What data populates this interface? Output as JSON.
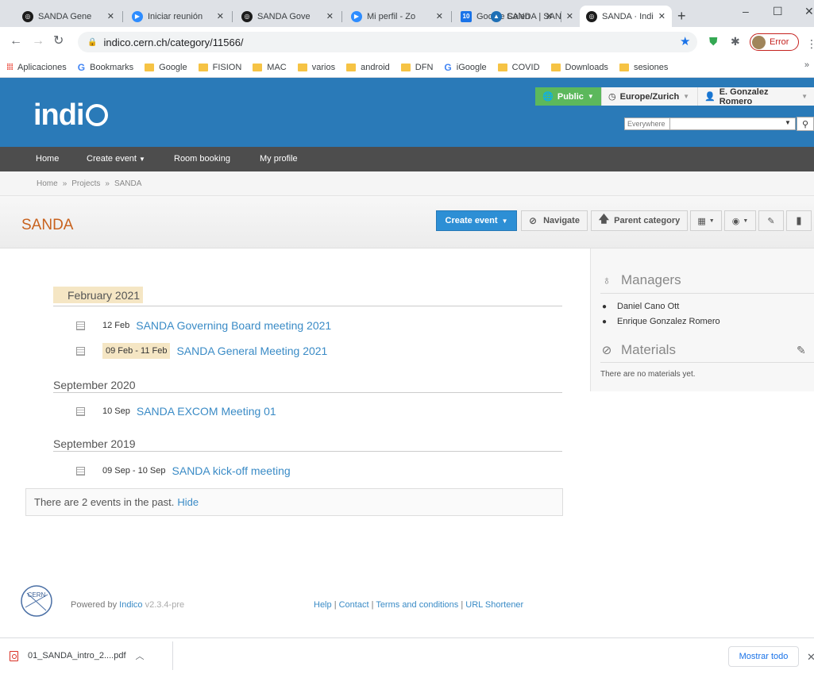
{
  "browser": {
    "tabs": [
      {
        "title": "SANDA Gene",
        "favicon_color": "#1b1b1b"
      },
      {
        "title": "Iniciar reunión",
        "favicon_color": "#2d8cff"
      },
      {
        "title": "SANDA Gove",
        "favicon_color": "#1b1b1b"
      },
      {
        "title": "Mi perfil - Zo",
        "favicon_color": "#2d8cff"
      },
      {
        "title": "Google Calen",
        "favicon_color": "#1a73e8"
      },
      {
        "title": "SANDA | SAN",
        "favicon_color": "#1e6fb5"
      },
      {
        "title": "SANDA · Indi",
        "favicon_color": "#1b1b1b"
      }
    ],
    "new_tab": "+",
    "window_controls": {
      "minimize": "–",
      "maximize": "☐",
      "close": "✕"
    },
    "url": "indico.cern.ch/category/11566/",
    "profile_status": "Error",
    "bookmarks": [
      {
        "label": "Aplicaciones",
        "icon": "apps-icon"
      },
      {
        "label": "Bookmarks",
        "icon": "google-icon"
      },
      {
        "label": "Google",
        "icon": "folder-icon"
      },
      {
        "label": "FISION",
        "icon": "folder-icon"
      },
      {
        "label": "MAC",
        "icon": "folder-icon"
      },
      {
        "label": "varios",
        "icon": "folder-icon"
      },
      {
        "label": "android",
        "icon": "folder-icon"
      },
      {
        "label": "DFN",
        "icon": "folder-icon"
      },
      {
        "label": "iGoogle",
        "icon": "google-icon"
      },
      {
        "label": "COVID",
        "icon": "folder-icon"
      },
      {
        "label": "Downloads",
        "icon": "folder-icon"
      },
      {
        "label": "sesiones",
        "icon": "folder-icon"
      }
    ],
    "bookmarks_more": "»"
  },
  "header": {
    "logo_text": "indi",
    "public_label": "Public",
    "timezone_label": "Europe/Zurich",
    "user_label": "E. Gonzalez Romero",
    "search_scope": "Everywhere",
    "search_value": ""
  },
  "nav": {
    "items": [
      "Home",
      "Create event",
      "Room booking",
      "My profile"
    ]
  },
  "breadcrumb": [
    "Home",
    "Projects",
    "SANDA"
  ],
  "category": {
    "title": "SANDA",
    "create_event_label": "Create event",
    "navigate_label": "Navigate",
    "parent_category_label": "Parent category"
  },
  "events_by_month": [
    {
      "month": "February 2021",
      "highlight": true,
      "events": [
        {
          "date": "12 Feb",
          "title": "SANDA Governing Board meeting 2021",
          "highlight": false
        },
        {
          "date": "09 Feb - 11 Feb",
          "title": "SANDA General Meeting 2021",
          "highlight": true
        }
      ]
    },
    {
      "month": "September 2020",
      "highlight": false,
      "events": [
        {
          "date": "10 Sep",
          "title": "SANDA EXCOM Meeting 01",
          "highlight": false
        }
      ]
    },
    {
      "month": "September 2019",
      "highlight": false,
      "events": [
        {
          "date": "09 Sep - 10 Sep",
          "title": "SANDA kick-off meeting",
          "highlight": false
        }
      ]
    }
  ],
  "past_events": {
    "text": "There are 2 events in the past.",
    "hide_label": "Hide"
  },
  "sidebar": {
    "managers_heading": "Managers",
    "managers": [
      "Daniel Cano Ott",
      "Enrique Gonzalez Romero"
    ],
    "materials_heading": "Materials",
    "materials_empty": "There are no materials yet."
  },
  "footer": {
    "powered_prefix": "Powered by",
    "indico_link": "Indico",
    "version": "v2.3.4-pre",
    "links": [
      "Help",
      "Contact",
      "Terms and conditions",
      "URL Shortener"
    ],
    "cern_logo_text": "CERN"
  },
  "downloads": {
    "file": "01_SANDA_intro_2....pdf",
    "show_all": "Mostrar todo"
  },
  "colors": {
    "header_blue": "#2a7ab8",
    "title_orange": "#c8621e",
    "link_blue": "#3a8bc6",
    "public_green": "#5cb85c",
    "highlight": "#f5e6c4"
  }
}
